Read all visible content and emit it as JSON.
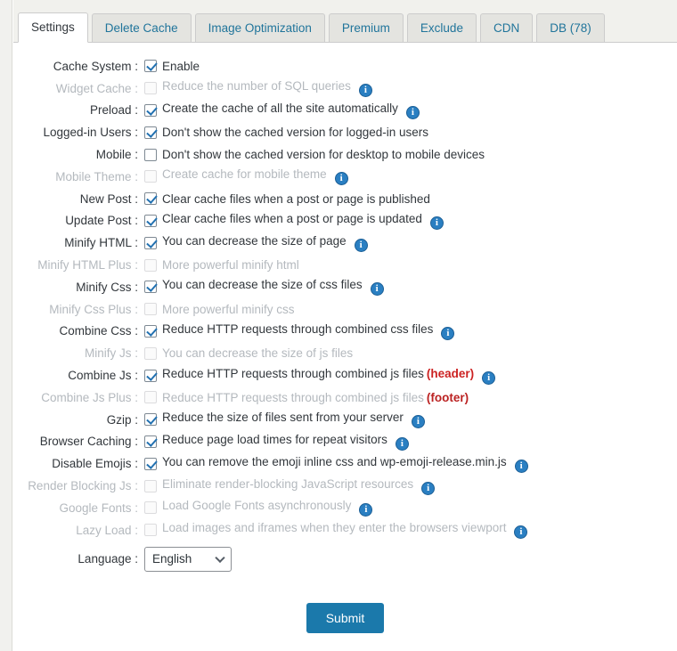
{
  "tabs": [
    {
      "label": "Settings",
      "active": true
    },
    {
      "label": "Delete Cache",
      "active": false
    },
    {
      "label": "Image Optimization",
      "active": false
    },
    {
      "label": "Premium",
      "active": false
    },
    {
      "label": "Exclude",
      "active": false
    },
    {
      "label": "CDN",
      "active": false
    },
    {
      "label": "DB (78)",
      "active": false
    }
  ],
  "colors": {
    "accent": "#1b79ab",
    "tab_link": "#21759b",
    "info_icon": "#2a7fc2",
    "tag_red": "#cc2222",
    "checkmark": "#2271b1",
    "disabled_text": "#b4b9be"
  },
  "settings": {
    "rows": [
      {
        "label": "Cache System :",
        "desc": "Enable",
        "checked": true,
        "disabled": false,
        "info": false,
        "tag": ""
      },
      {
        "label": "Widget Cache :",
        "desc": "Reduce the number of SQL queries",
        "checked": false,
        "disabled": true,
        "info": true,
        "tag": ""
      },
      {
        "label": "Preload :",
        "desc": "Create the cache of all the site automatically",
        "checked": true,
        "disabled": false,
        "info": true,
        "tag": ""
      },
      {
        "label": "Logged-in Users :",
        "desc": "Don't show the cached version for logged-in users",
        "checked": true,
        "disabled": false,
        "info": false,
        "tag": ""
      },
      {
        "label": "Mobile :",
        "desc": "Don't show the cached version for desktop to mobile devices",
        "checked": false,
        "disabled": false,
        "info": false,
        "tag": ""
      },
      {
        "label": "Mobile Theme :",
        "desc": "Create cache for mobile theme",
        "checked": false,
        "disabled": true,
        "info": true,
        "tag": ""
      },
      {
        "label": "New Post :",
        "desc": "Clear cache files when a post or page is published",
        "checked": true,
        "disabled": false,
        "info": false,
        "tag": ""
      },
      {
        "label": "Update Post :",
        "desc": "Clear cache files when a post or page is updated",
        "checked": true,
        "disabled": false,
        "info": true,
        "tag": ""
      },
      {
        "label": "Minify HTML :",
        "desc": "You can decrease the size of page",
        "checked": true,
        "disabled": false,
        "info": true,
        "tag": ""
      },
      {
        "label": "Minify HTML Plus :",
        "desc": "More powerful minify html",
        "checked": false,
        "disabled": true,
        "info": false,
        "tag": ""
      },
      {
        "label": "Minify Css :",
        "desc": "You can decrease the size of css files",
        "checked": true,
        "disabled": false,
        "info": true,
        "tag": ""
      },
      {
        "label": "Minify Css Plus :",
        "desc": "More powerful minify css",
        "checked": false,
        "disabled": true,
        "info": false,
        "tag": ""
      },
      {
        "label": "Combine Css :",
        "desc": "Reduce HTTP requests through combined css files",
        "checked": true,
        "disabled": false,
        "info": true,
        "tag": ""
      },
      {
        "label": "Minify Js :",
        "desc": "You can decrease the size of js files",
        "checked": false,
        "disabled": true,
        "info": false,
        "tag": ""
      },
      {
        "label": "Combine Js :",
        "desc": "Reduce HTTP requests through combined js files",
        "checked": true,
        "disabled": false,
        "info": true,
        "tag": "(header)"
      },
      {
        "label": "Combine Js Plus :",
        "desc": "Reduce HTTP requests through combined js files",
        "checked": false,
        "disabled": true,
        "info": false,
        "tag": "(footer)"
      },
      {
        "label": "Gzip :",
        "desc": "Reduce the size of files sent from your server",
        "checked": true,
        "disabled": false,
        "info": true,
        "tag": ""
      },
      {
        "label": "Browser Caching :",
        "desc": "Reduce page load times for repeat visitors",
        "checked": true,
        "disabled": false,
        "info": true,
        "tag": ""
      },
      {
        "label": "Disable Emojis :",
        "desc": "You can remove the emoji inline css and wp-emoji-release.min.js",
        "checked": true,
        "disabled": false,
        "info": true,
        "tag": ""
      },
      {
        "label": "Render Blocking Js :",
        "desc": "Eliminate render-blocking JavaScript resources",
        "checked": false,
        "disabled": true,
        "info": true,
        "tag": ""
      },
      {
        "label": "Google Fonts :",
        "desc": "Load Google Fonts asynchronously",
        "checked": false,
        "disabled": true,
        "info": true,
        "tag": ""
      },
      {
        "label": "Lazy Load :",
        "desc": "Load images and iframes when they enter the browsers viewport",
        "checked": false,
        "disabled": true,
        "info": true,
        "tag": ""
      }
    ],
    "language": {
      "label": "Language :",
      "value": "English",
      "options": [
        "English"
      ]
    },
    "submit_label": "Submit"
  },
  "icons": {
    "info": "i",
    "chevron_down": "chevron-down-icon"
  }
}
